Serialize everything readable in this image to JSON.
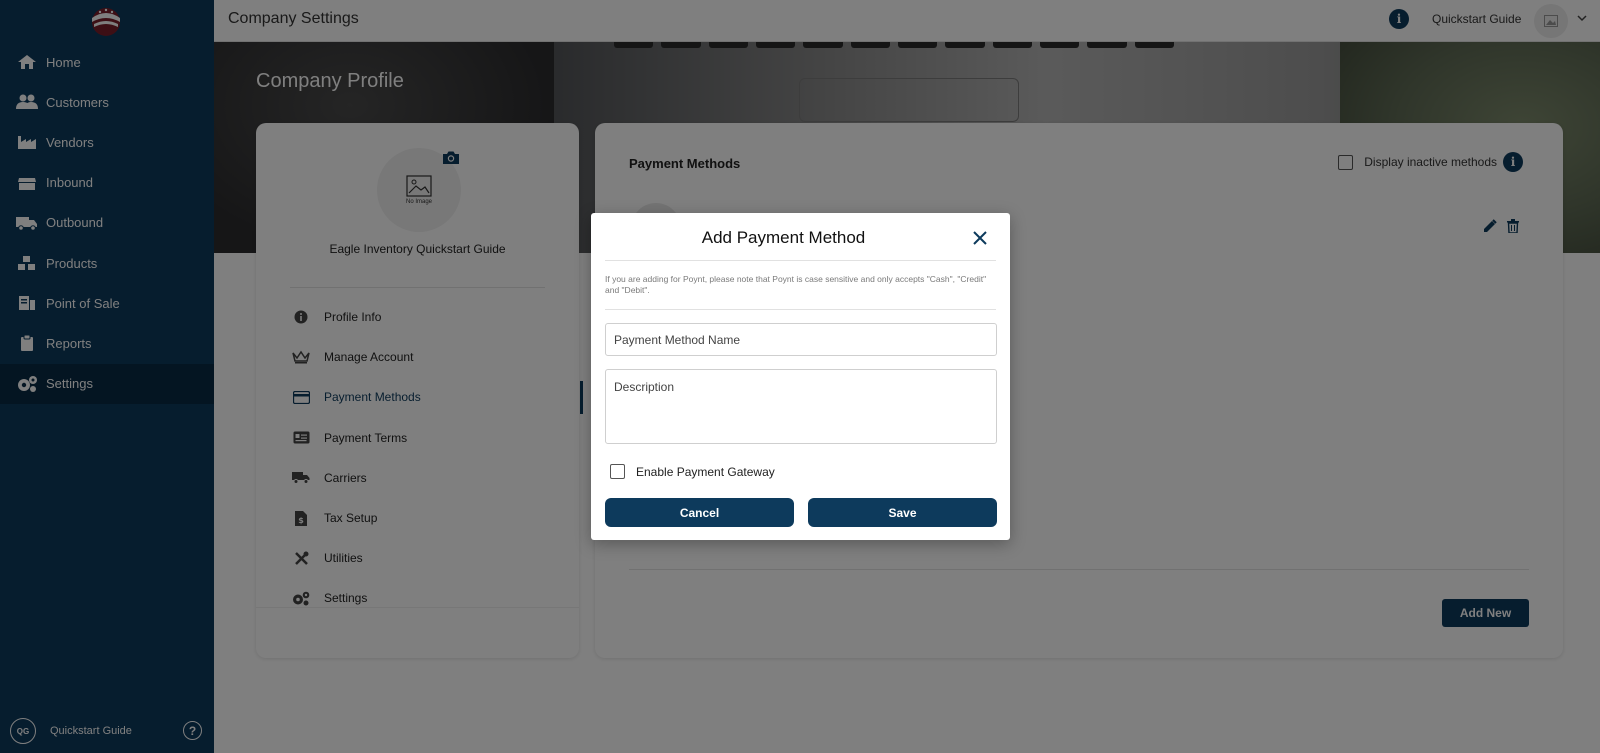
{
  "app": {
    "window_title": "Company Settings",
    "quickstart_label": "Quickstart Guide"
  },
  "sidebar": {
    "items": [
      {
        "label": "Home",
        "icon": "home-icon"
      },
      {
        "label": "Customers",
        "icon": "users-icon"
      },
      {
        "label": "Vendors",
        "icon": "factory-icon"
      },
      {
        "label": "Inbound",
        "icon": "inbox-icon"
      },
      {
        "label": "Outbound",
        "icon": "truck-icon"
      },
      {
        "label": "Products",
        "icon": "boxes-icon"
      },
      {
        "label": "Point of Sale",
        "icon": "receipt-icon"
      },
      {
        "label": "Reports",
        "icon": "clipboard-icon"
      },
      {
        "label": "Settings",
        "icon": "gears-icon",
        "active": true
      }
    ],
    "footer": {
      "badge": "QG",
      "label": "Quickstart Guide"
    }
  },
  "page": {
    "heading": "Company Profile"
  },
  "profile": {
    "no_image_text": "No Image",
    "company_name": "Eagle Inventory Quickstart Guide",
    "menu": [
      {
        "label": "Profile Info",
        "icon": "info-icon"
      },
      {
        "label": "Manage Account",
        "icon": "crown-icon"
      },
      {
        "label": "Payment Methods",
        "icon": "credit-card-icon",
        "active": true
      },
      {
        "label": "Payment Terms",
        "icon": "id-card-icon"
      },
      {
        "label": "Carriers",
        "icon": "truck-icon"
      },
      {
        "label": "Tax Setup",
        "icon": "file-dollar-icon"
      },
      {
        "label": "Utilities",
        "icon": "tools-icon"
      },
      {
        "label": "Settings",
        "icon": "gears-icon"
      }
    ]
  },
  "payment_methods": {
    "title": "Payment Methods",
    "display_inactive_label": "Display inactive methods",
    "add_new_label": "Add New"
  },
  "modal": {
    "title": "Add Payment Method",
    "notice": "If you are adding for Poynt, please note that Poynt is case sensitive and only accepts \"Cash\", \"Credit\" and \"Debit\".",
    "name_placeholder": "Payment Method Name",
    "description_placeholder": "Description",
    "gateway_label": "Enable Payment Gateway",
    "cancel_label": "Cancel",
    "save_label": "Save"
  },
  "colors": {
    "primary": "#0d3a5c",
    "sidebar_active": "#082a45"
  }
}
